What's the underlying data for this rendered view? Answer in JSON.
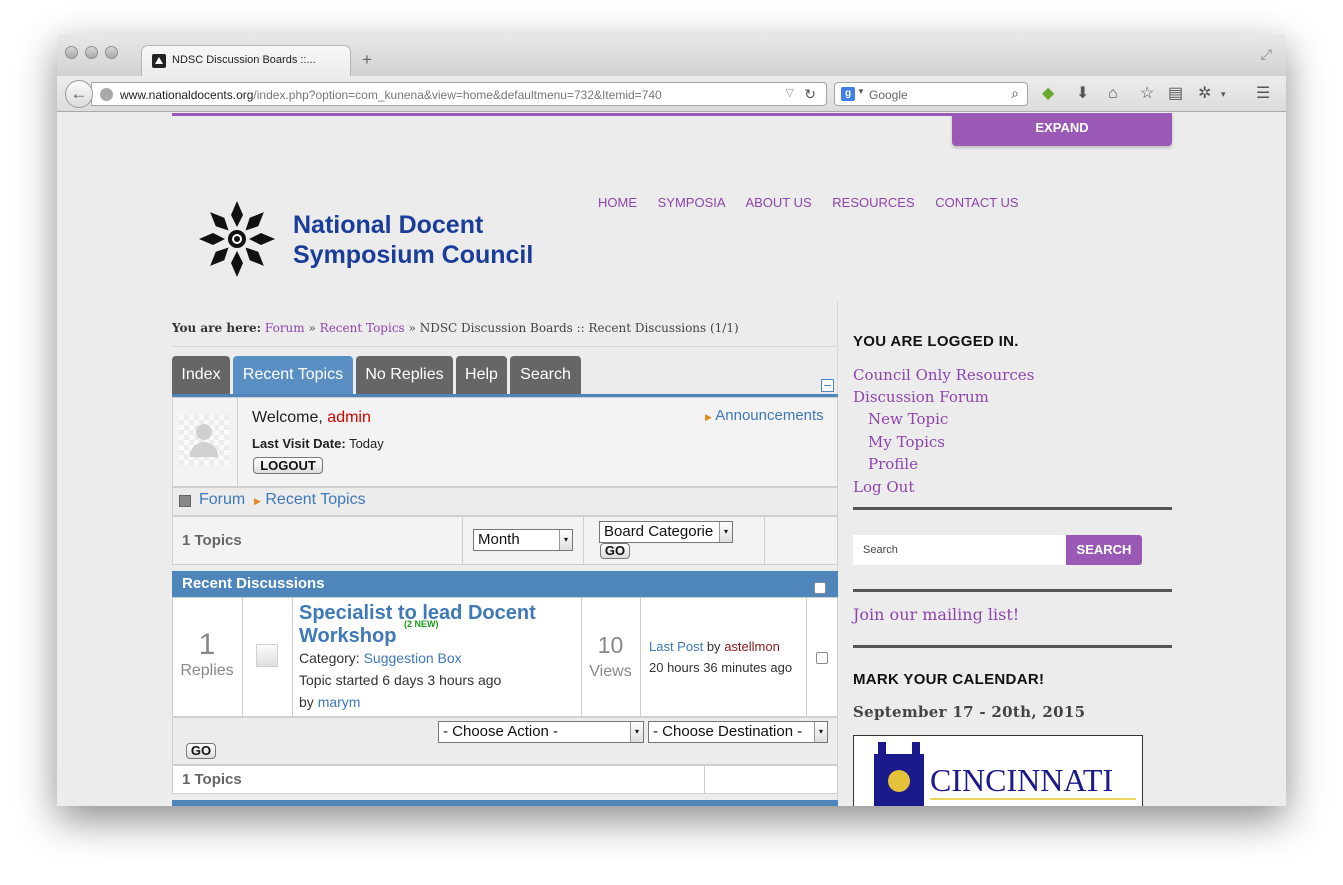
{
  "browser": {
    "tab_title": "NDSC Discussion Boards ::...",
    "new_tab": "+",
    "url_domain": "www.nationaldocents.org",
    "url_path": "/index.php?option=com_kunena&view=home&defaultmenu=732&Itemid=740",
    "search_engine_letter": "g",
    "search_placeholder": "Google"
  },
  "header": {
    "expand_label": "EXPAND",
    "logo_line1": "National Docent",
    "logo_line2": "Symposium Council",
    "nav": [
      "HOME",
      "SYMPOSIA",
      "ABOUT US",
      "RESOURCES",
      "CONTACT US"
    ]
  },
  "breadcrumb": {
    "label": "You are here:",
    "forum": "Forum",
    "sep": "»",
    "recent": "Recent Topics",
    "current": "NDSC Discussion Boards :: Recent Discussions (1/1)"
  },
  "forum": {
    "tabs": [
      "Index",
      "Recent Topics",
      "No Replies",
      "Help",
      "Search"
    ],
    "welcome_prefix": "Welcome,",
    "username": "admin",
    "last_visit_label": "Last Visit Date:",
    "last_visit_value": "Today",
    "logout_label": "LOGOUT",
    "announcements": "Announcements",
    "path_forum": "Forum",
    "path_recent": "Recent Topics",
    "topics_count": "1 Topics",
    "time_filter": "Month",
    "category_filter": "Board Categorie",
    "go_label": "GO",
    "category_title": "Recent Discussions",
    "topic": {
      "replies_count": "1",
      "replies_label": "Replies",
      "title_line1": "Specialist to lead Docent",
      "title_line2": "Workshop",
      "new_badge": "(2 NEW)",
      "category_label": "Category:",
      "category_value": "Suggestion Box",
      "started": "Topic started 6 days 3 hours ago",
      "by_label": "by",
      "author": "marym",
      "views_count": "10",
      "views_label": "Views",
      "last_post_label": "Last Post",
      "last_post_by": "by",
      "last_post_user": "astellmon",
      "last_post_time": "20 hours 36 minutes ago"
    },
    "choose_action": "- Choose Action -",
    "choose_destination": "- Choose Destination -",
    "footer_count": "1 Topics"
  },
  "sidebar": {
    "logged_in_title": "YOU ARE LOGGED IN.",
    "links": [
      "Council Only Resources",
      "Discussion Forum",
      "New Topic",
      "My Topics",
      "Profile",
      "Log Out"
    ],
    "search_placeholder": "Search",
    "search_button": "SEARCH",
    "mailing_list": "Join our mailing list!",
    "calendar_title": "MARK YOUR CALENDAR!",
    "calendar_date": "September 17 - 20th,  2015",
    "calendar_image_text": "CINCINNATI"
  },
  "colors": {
    "accent_purple": "#9b59b6",
    "forum_blue": "#4e86bc",
    "logo_blue": "#1a3d99"
  }
}
